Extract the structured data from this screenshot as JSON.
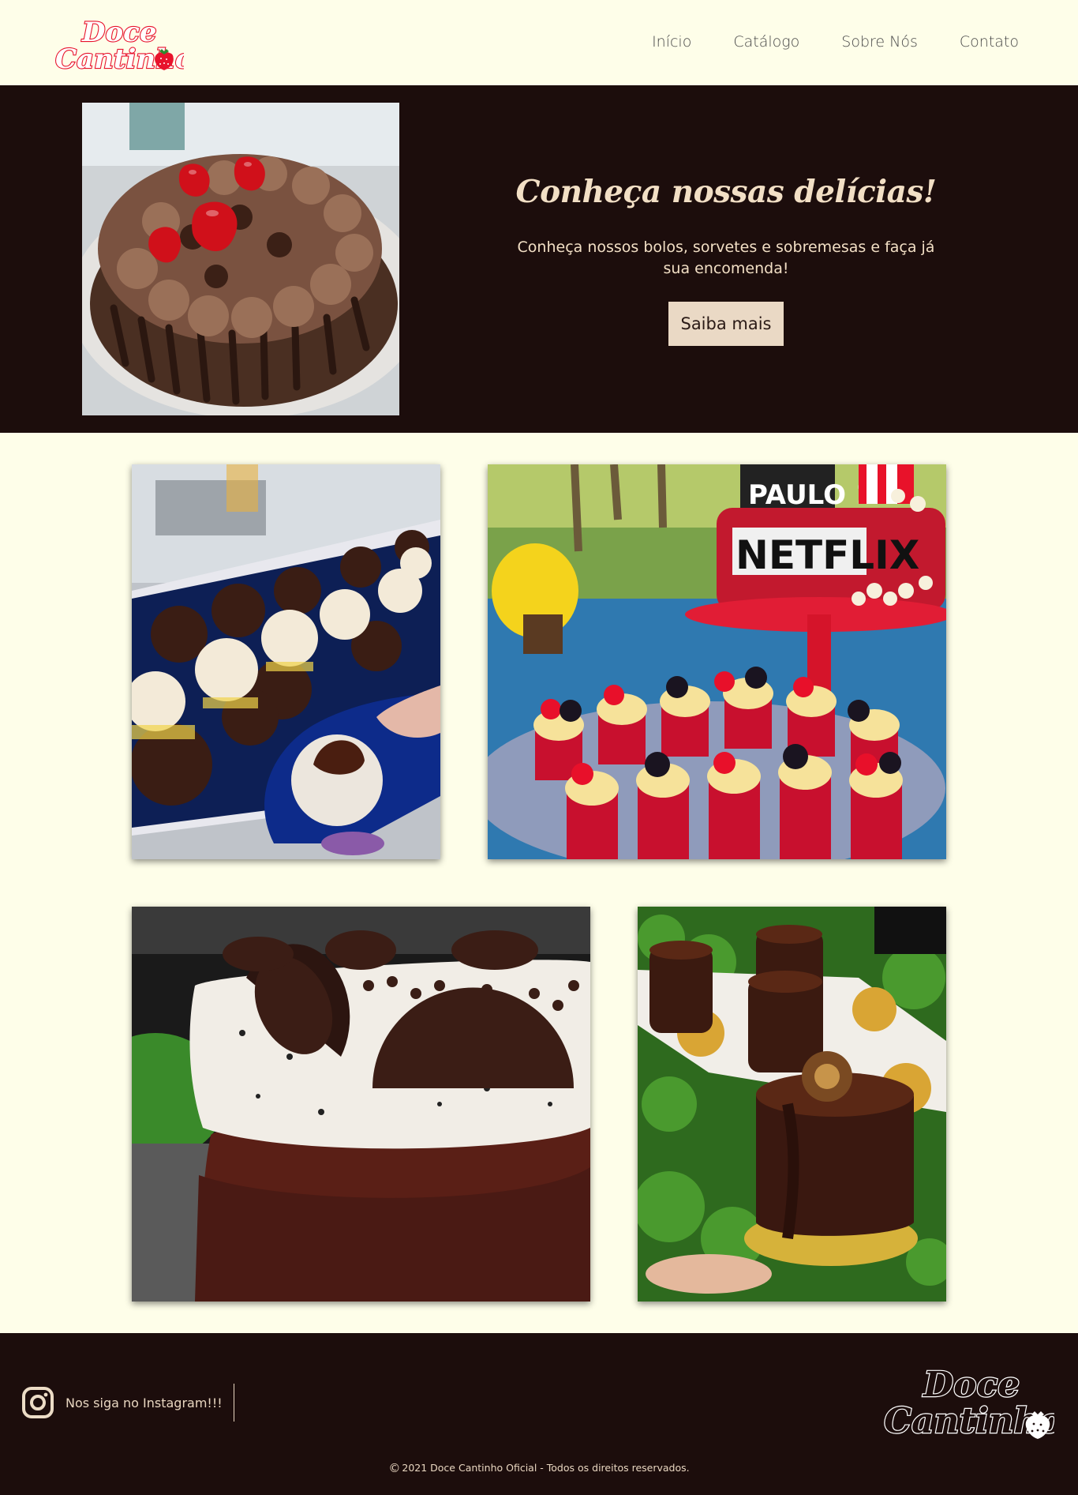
{
  "header": {
    "logo_text": [
      "Doce",
      "Cantinho"
    ],
    "nav": [
      "Início",
      "Catálogo",
      "Sobre Nós",
      "Contato"
    ]
  },
  "hero": {
    "title": "Conheça nossas delícias!",
    "subtitle": "Conheça nossos bolos, sorvetes e sobremesas e faça já sua encomenda!",
    "button": "Saiba mais"
  },
  "gallery": {
    "cake_topper_name": "PAULO 12",
    "cake_brand_text": "NETFLIX"
  },
  "footer": {
    "instagram_label": "Nos siga no Instagram!!!",
    "copyright_symbol": "©",
    "copyright": "2021 Doce Cantinho Oficial - Todos os direitos reservados."
  },
  "colors": {
    "background": "#fefee9",
    "dark": "#1c0d0c",
    "cream_text": "#f2dfc5",
    "button": "#ead9c5",
    "logo_red": "#e8132c"
  },
  "icons": [
    "instagram-icon",
    "strawberry-icon",
    "copyright-icon"
  ]
}
